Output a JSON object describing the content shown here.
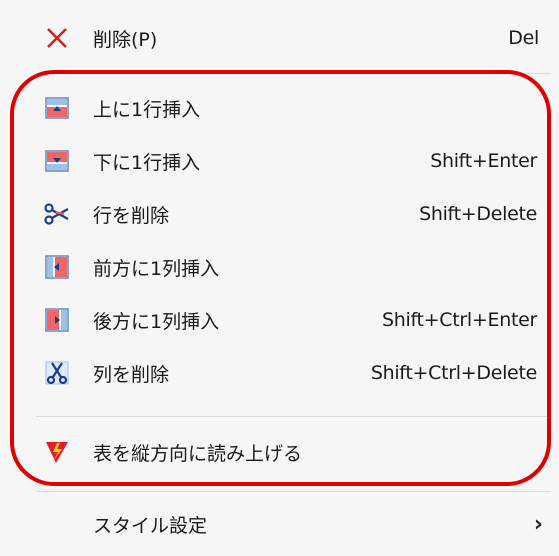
{
  "menu": {
    "delete": {
      "label": "削除(P)",
      "shortcut": "Del",
      "icon": "x-icon",
      "color": "#d32020"
    },
    "insert_row_above": {
      "label": "上に1行挿入",
      "shortcut": "",
      "icon": "insert-row-above-icon"
    },
    "insert_row_below": {
      "label": "下に1行挿入",
      "shortcut": "Shift+Enter",
      "icon": "insert-row-below-icon"
    },
    "delete_row": {
      "label": "行を削除",
      "shortcut": "Shift+Delete",
      "icon": "scissors-row-icon"
    },
    "insert_col_before": {
      "label": "前方に1列挿入",
      "shortcut": "",
      "icon": "insert-column-before-icon"
    },
    "insert_col_after": {
      "label": "後方に1列挿入",
      "shortcut": "Shift+Ctrl+Enter",
      "icon": "insert-column-after-icon"
    },
    "delete_col": {
      "label": "列を削除",
      "shortcut": "Shift+Ctrl+Delete",
      "icon": "scissors-column-icon"
    },
    "read_table_vertical": {
      "label": "表を縦方向に読み上げる",
      "shortcut": "",
      "icon": "read-aloud-icon"
    },
    "style_settings": {
      "label": "スタイル設定",
      "shortcut": "",
      "icon": "chevron-right-icon"
    }
  },
  "highlight_color": "#e00000"
}
